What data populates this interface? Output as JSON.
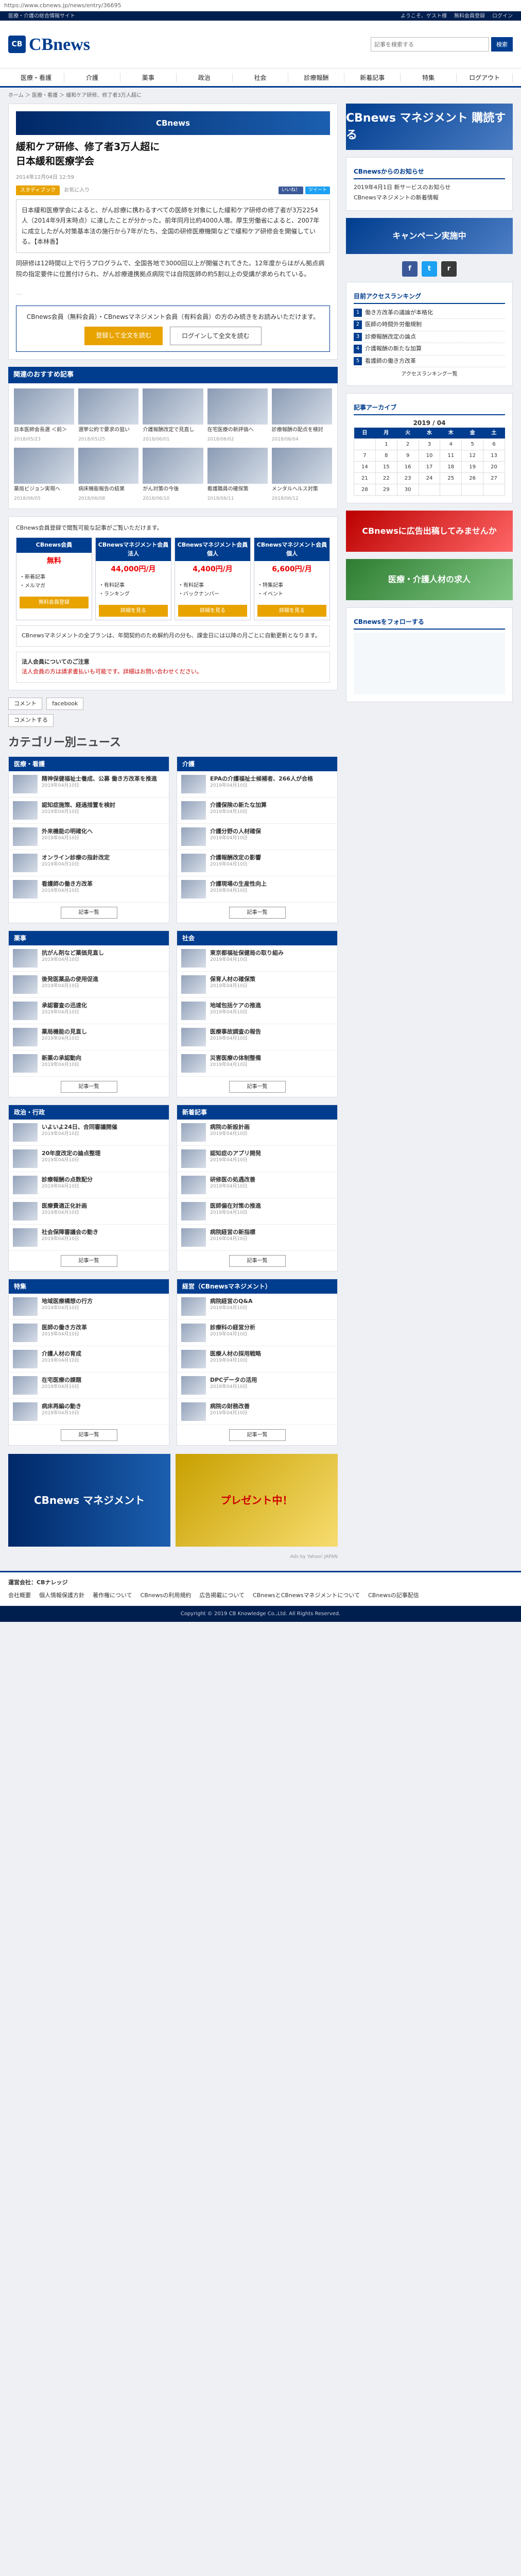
{
  "browser": {
    "url": "https://www.cbnews.jp/news/entry/36695"
  },
  "topbar": {
    "left": "医療・介護の総合情報サイト",
    "right": [
      "ようこそ、ゲスト様",
      "無料会員登録",
      "ログイン"
    ]
  },
  "header": {
    "logo": "CBnews",
    "search_placeholder": "記事を検索する",
    "search_button": "検索"
  },
  "gnav": [
    "医療・看護",
    "介護",
    "薬事",
    "政治",
    "社会",
    "診療報酬",
    "新着記事",
    "特集",
    "ログアウト"
  ],
  "breadcrumb": "ホーム ＞ 医療・看護 ＞ 緩和ケア研修、修了者3万人超に",
  "article": {
    "title": "緩和ケア研修、修了者3万人超に\n日本緩和医療学会",
    "date": "2014年12月04日 12:59",
    "tag": "スタディブック",
    "bookmark": "お気に入り",
    "lead": "日本緩和医療学会によると、がん診療に携わるすべての医師を対象にした緩和ケア研修の修了者が3万2254人（2014年9月末時点）に達したことが分かった。前年同月比約4000人増。厚生労働省によると、2007年に成立したがん対策基本法の施行から7年がたち、全国の研修医療機関などで緩和ケア研修会を開催している。【本林香】",
    "body": "同研修は12時間以上で行うプログラムで、全国各地で3000回以上が開催されてきた。12年度からはがん拠点病院の指定要件に位置付けられ、がん診療連携拠点病院では自院医師の約5割以上の受講が求められている。",
    "members_text": "CBnews会員（無料会員）・CBnewsマネジメント会員（有料会員）の方のみ続きをお読みいただけます。",
    "members_btn1": "登録して全文を読む",
    "members_btn2": "ログインして全文を読む"
  },
  "recommend": {
    "title": "関連のおすすめ記事",
    "items": [
      {
        "t": "日本医師会長選 ＜前＞",
        "d": "2018/05/23"
      },
      {
        "t": "選挙公約で要求の狙い",
        "d": "2018/05/25"
      },
      {
        "t": "介護報酬改定で見直し",
        "d": "2018/06/01"
      },
      {
        "t": "在宅医療の新評価へ",
        "d": "2018/06/02"
      },
      {
        "t": "診療報酬の配点を検討",
        "d": "2018/06/04"
      },
      {
        "t": "薬局ビジョン実現へ",
        "d": "2018/06/05"
      },
      {
        "t": "病床機能報告の結果",
        "d": "2018/06/08"
      },
      {
        "t": "がん対策の今後",
        "d": "2018/06/10"
      },
      {
        "t": "看護職員の確保策",
        "d": "2018/06/11"
      },
      {
        "t": "メンタルヘルス対策",
        "d": "2018/06/12"
      }
    ]
  },
  "plans": {
    "intro": "CBnews会員登録で閲覧可能な記事がご覧いただけます。",
    "items": [
      {
        "name": "CBnews会員",
        "price": "無料",
        "cta": "無料会員登録",
        "features": [
          "新着記事",
          "メルマガ"
        ]
      },
      {
        "name": "CBnewsマネジメント会員 法人",
        "price": "44,000円/月",
        "cta": "詳細を見る",
        "features": [
          "有料記事",
          "ランキング"
        ]
      },
      {
        "name": "CBnewsマネジメント会員 個人",
        "price": "4,400円/月",
        "cta": "詳細を見る",
        "features": [
          "有料記事",
          "バックナンバー"
        ]
      },
      {
        "name": "CBnewsマネジメント会員 個人",
        "price": "6,600円/月",
        "cta": "詳細を見る",
        "features": [
          "特集記事",
          "イベント"
        ]
      }
    ],
    "note1": "CBnewsマネジメントの全プランは、年間契約のため解約月の分も、課金日には以降の月ごとに自動更新となります。",
    "note2": "法人会員についてのご注意",
    "note3": "法人会員の方は請求書払いも可能です。詳細はお問い合わせください。"
  },
  "comments": {
    "tab1": "コメント",
    "tab2": "facebook",
    "btn": "コメントする"
  },
  "category": {
    "title": "カテゴリー別ニュース",
    "more": "記事一覧",
    "sections": [
      {
        "name": "医療・看護",
        "items": [
          {
            "t": "精神保健福祉士養成、公募 働き方改革を推進",
            "d": "2019年04月10日"
          },
          {
            "t": "認知症施策、経過措置を検討",
            "d": "2019年04月10日"
          },
          {
            "t": "外来機能の明確化へ",
            "d": "2019年04月10日"
          },
          {
            "t": "オンライン診療の指針改定",
            "d": "2019年04月10日"
          },
          {
            "t": "看護師の働き方改革",
            "d": "2019年04月10日"
          }
        ]
      },
      {
        "name": "介護",
        "items": [
          {
            "t": "EPAの介護福祉士候補者、266人が合格",
            "d": "2019年04月10日"
          },
          {
            "t": "介護保険の新たな加算",
            "d": "2019年04月10日"
          },
          {
            "t": "介護分野の人材確保",
            "d": "2019年04月10日"
          },
          {
            "t": "介護報酬改定の影響",
            "d": "2019年04月10日"
          },
          {
            "t": "介護現場の生産性向上",
            "d": "2019年04月10日"
          }
        ]
      },
      {
        "name": "薬事",
        "items": [
          {
            "t": "抗がん剤など薬価見直し",
            "d": "2019年04月10日"
          },
          {
            "t": "後発医薬品の使用促進",
            "d": "2019年04月10日"
          },
          {
            "t": "承認審査の迅速化",
            "d": "2019年04月10日"
          },
          {
            "t": "薬局機能の見直し",
            "d": "2019年04月10日"
          },
          {
            "t": "新薬の承認動向",
            "d": "2019年04月10日"
          }
        ]
      },
      {
        "name": "社会",
        "items": [
          {
            "t": "東京都福祉保健局の取り組み",
            "d": "2019年04月10日"
          },
          {
            "t": "保育人材の確保策",
            "d": "2019年04月10日"
          },
          {
            "t": "地域包括ケアの推進",
            "d": "2019年04月10日"
          },
          {
            "t": "医療事故調査の報告",
            "d": "2019年04月10日"
          },
          {
            "t": "災害医療の体制整備",
            "d": "2019年04月10日"
          }
        ]
      },
      {
        "name": "政治・行政",
        "items": [
          {
            "t": "いよいよ24日、合同審議開催",
            "d": "2019年04月10日"
          },
          {
            "t": "20年度改定の論点整理",
            "d": "2019年04月10日"
          },
          {
            "t": "診療報酬の点数配分",
            "d": "2019年04月10日"
          },
          {
            "t": "医療費適正化計画",
            "d": "2019年04月10日"
          },
          {
            "t": "社会保障審議会の動き",
            "d": "2019年04月10日"
          }
        ]
      },
      {
        "name": "新着記事",
        "items": [
          {
            "t": "病院の新設計画",
            "d": "2019年04月10日"
          },
          {
            "t": "認知症のアプリ開発",
            "d": "2019年04月10日"
          },
          {
            "t": "研修医の処遇改善",
            "d": "2019年04月10日"
          },
          {
            "t": "医師偏在対策の推進",
            "d": "2019年04月10日"
          },
          {
            "t": "病院経営の新指標",
            "d": "2019年04月10日"
          }
        ]
      },
      {
        "name": "特集",
        "items": [
          {
            "t": "地域医療構想の行方",
            "d": "2019年04月10日"
          },
          {
            "t": "医師の働き方改革",
            "d": "2019年04月10日"
          },
          {
            "t": "介護人材の育成",
            "d": "2019年04月10日"
          },
          {
            "t": "在宅医療の課題",
            "d": "2019年04月10日"
          },
          {
            "t": "病床再編の動き",
            "d": "2019年04月10日"
          }
        ]
      },
      {
        "name": "経営（CBnewsマネジメント）",
        "items": [
          {
            "t": "病院経営のQ&A",
            "d": "2019年04月10日"
          },
          {
            "t": "診療科の経営分析",
            "d": "2019年04月10日"
          },
          {
            "t": "医療人材の採用戦略",
            "d": "2019年04月10日"
          },
          {
            "t": "DPCデータの活用",
            "d": "2019年04月10日"
          },
          {
            "t": "病院の財務改善",
            "d": "2019年04月10日"
          }
        ]
      }
    ]
  },
  "ad": {
    "banner1": "CBnews マネジメント",
    "banner2": "プレゼント中！",
    "provider": "Ads by Yahoo! JAPAN"
  },
  "sidebar": {
    "banner1": "CBnews マネジメント 購読する",
    "info_title": "CBnewsからのお知らせ",
    "info": [
      "2019年4月1日 新サービスのお知らせ",
      "CBnewsマネジメントの新着情報"
    ],
    "campaign": "キャンペーン実施中",
    "ranking_title": "目前アクセスランキング",
    "ranking": [
      "働き方改革の議論が本格化",
      "医師の時間外労働規制",
      "診療報酬改定の論点",
      "介護報酬の新たな加算",
      "看護師の働き方改革"
    ],
    "ranking_more": "アクセスランキング一覧",
    "archive_title": "記事アーカイブ",
    "month": "2019 / 04",
    "weekdays": [
      "日",
      "月",
      "火",
      "水",
      "木",
      "金",
      "土"
    ],
    "days": [
      "",
      "1",
      "2",
      "3",
      "4",
      "5",
      "6",
      "7",
      "8",
      "9",
      "10",
      "11",
      "12",
      "13",
      "14",
      "15",
      "16",
      "17",
      "18",
      "19",
      "20",
      "21",
      "22",
      "23",
      "24",
      "25",
      "26",
      "27",
      "28",
      "29",
      "30",
      "",
      "",
      "",
      ""
    ],
    "banner2": "CBnewsに広告出稿してみませんか",
    "banner3": "医療・介護人材の求人",
    "twitter": "CBnewsをフォローする"
  },
  "footer": {
    "title": "運営会社：CBナレッジ",
    "links": [
      "会社概要",
      "個人情報保護方針",
      "著作権について",
      "CBnewsの利用規約",
      "広告掲載について",
      "CBnewsとCBnewsマネジメントについて",
      "CBnewsの記事配信"
    ],
    "copyright": "Copyright © 2019 CB Knowledge Co.,Ltd. All Rights Reserved."
  }
}
